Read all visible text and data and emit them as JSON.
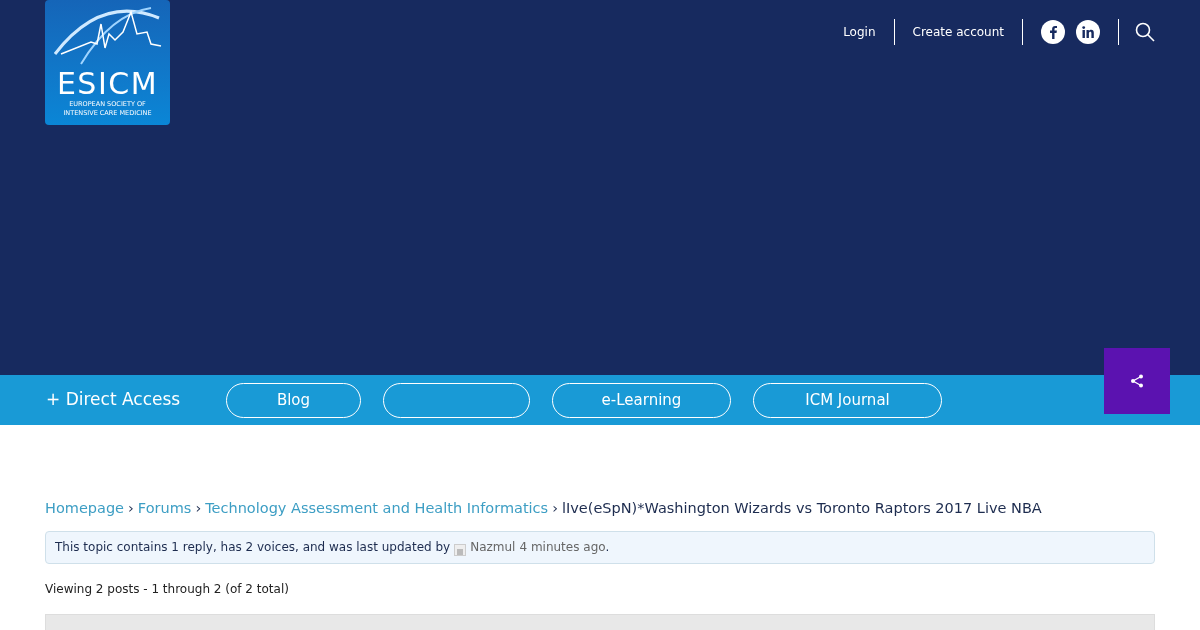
{
  "logo": {
    "name": "ESICM",
    "tagline": [
      "EUROPEAN SOCIETY OF",
      "INTENSIVE CARE MEDICINE"
    ]
  },
  "top_links": [
    "Login",
    "Create account"
  ],
  "social": [
    {
      "kind": "facebook"
    },
    {
      "kind": "linkedin"
    }
  ],
  "nav": {
    "direct_access": "+ Direct Access",
    "items": [
      {
        "kind": "link",
        "label": "Blog"
      },
      {
        "kind": "blank"
      },
      {
        "kind": "link",
        "label": "e-Learning"
      },
      {
        "kind": "link",
        "label": "ICM Journal"
      }
    ]
  },
  "breadcrumb": [
    "Homepage",
    "Forums",
    "Technology Assessment and Health Informatics"
  ],
  "breadcrumb_separator": "›",
  "title": "lIve(eSpN)*Washington Wizards vs Toronto Raptors 2017 Live NBA",
  "notice": {
    "text": "This topic contains 1 reply, has 2 voices, and was last updated by",
    "user": "Nazmul",
    "time": "4 minutes ago",
    "end": "."
  },
  "viewing": "Viewing 2 posts - 1 through 2 (of 2 total)"
}
